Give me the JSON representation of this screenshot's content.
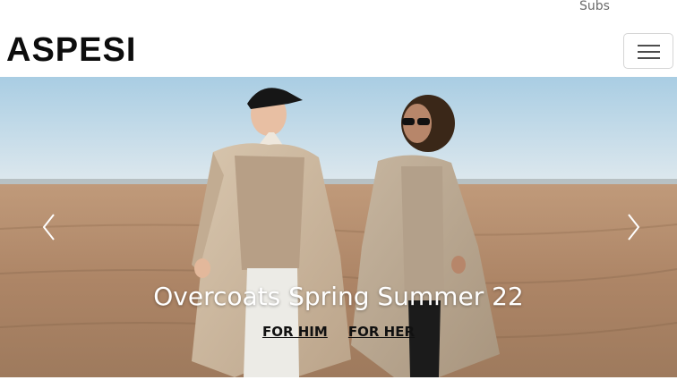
{
  "topbar": {
    "text": "Subs"
  },
  "header": {
    "logo": "ASPESI",
    "menu_icon": "hamburger-icon"
  },
  "hero": {
    "title": "Overcoats Spring Summer 22",
    "links": [
      "FOR HIM",
      "FOR HER"
    ],
    "prev_icon": "chevron-left-icon",
    "next_icon": "chevron-right-icon"
  },
  "colors": {
    "sky": "#c3dceb",
    "sand": "#b0896a",
    "coat": "#c9b49c"
  }
}
